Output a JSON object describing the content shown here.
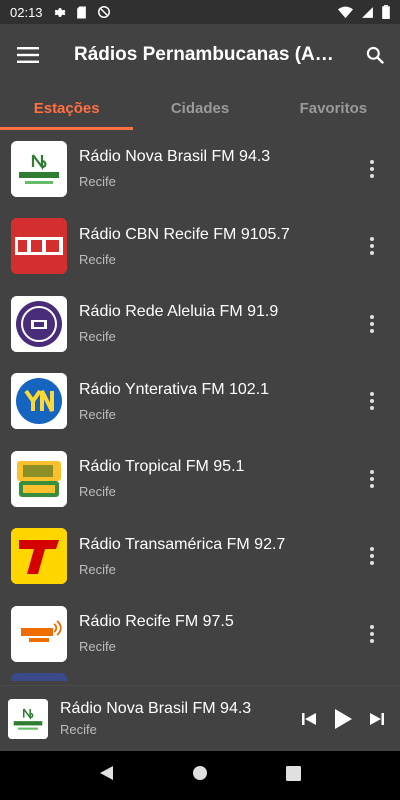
{
  "status": {
    "time": "02:13"
  },
  "toolbar": {
    "title": "Rádios Pernambucanas (A…",
    "menu_icon": "hamburger-menu-icon",
    "search_icon": "search-icon"
  },
  "tabs": [
    {
      "label": "Estações",
      "active": true
    },
    {
      "label": "Cidades",
      "active": false
    },
    {
      "label": "Favoritos",
      "active": false
    }
  ],
  "stations": [
    {
      "name": "Rádio Nova Brasil FM 94.3",
      "city": "Recife",
      "logo": "novabrasil"
    },
    {
      "name": "Rádio CBN Recife FM 9105.7",
      "city": "Recife",
      "logo": "CBN"
    },
    {
      "name": "Rádio Rede Aleluia FM 91.9",
      "city": "Recife",
      "logo": "93.5"
    },
    {
      "name": "Rádio Ynterativa FM 102.1",
      "city": "Recife",
      "logo": "YN"
    },
    {
      "name": "Rádio Tropical FM 95.1",
      "city": "Recife",
      "logo": "98.5 Tropical"
    },
    {
      "name": "Rádio Transamérica FM 92.7",
      "city": "Recife",
      "logo": "T"
    },
    {
      "name": "Rádio Recife FM 97.5",
      "city": "Recife",
      "logo": "RECIFE FM"
    }
  ],
  "player": {
    "name": "Rádio Nova Brasil FM 94.3",
    "city": "Recife",
    "logo": "novabrasil"
  },
  "colors": {
    "accent": "#ff7043",
    "background": "#424242",
    "status_bar": "#303030",
    "cbn_red": "#d32f2f",
    "aleluia_purple": "#4a2d7a",
    "yn_blue": "#1565c0",
    "trans_yellow": "#ffd600",
    "trans_red": "#d50000"
  }
}
